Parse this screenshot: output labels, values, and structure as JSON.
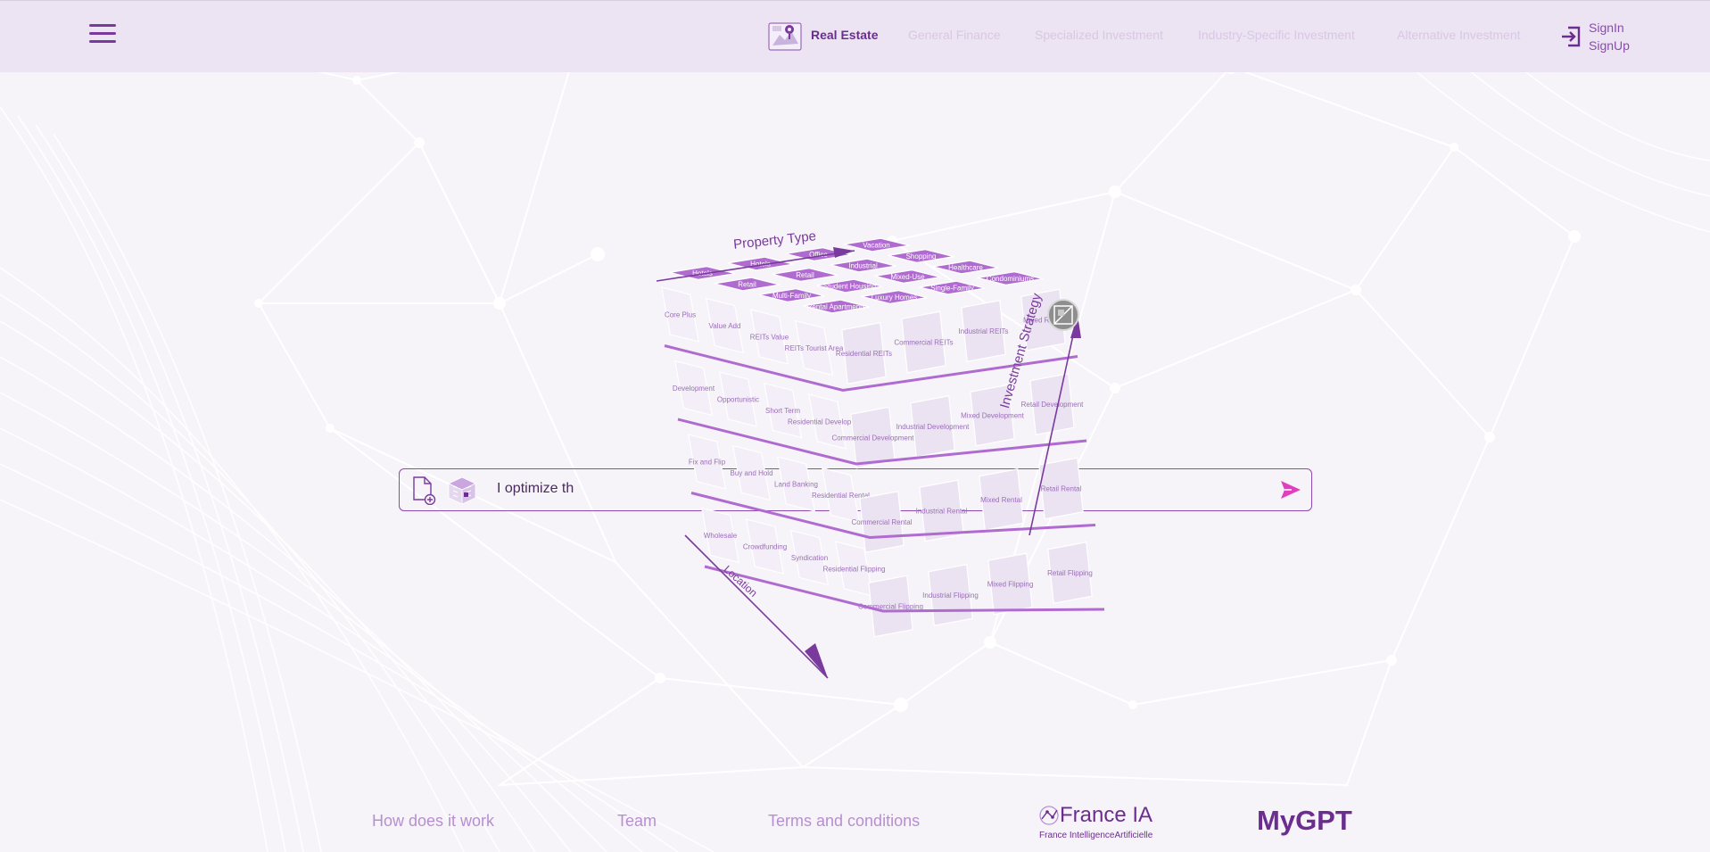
{
  "colors": {
    "accent": "#6b2e8f",
    "cube_top": "#b06bd0",
    "send": "#e040c0",
    "background": "#f6f3f9"
  },
  "header": {
    "menu_icon": "hamburger-menu-icon",
    "active_category": {
      "label": "Real Estate",
      "icon": "real-estate-map-icon"
    },
    "categories": [
      "General Finance",
      "Specialized Investment",
      "Industry-Specific Investment",
      "Alternative Investment"
    ],
    "auth": {
      "icon": "sign-in-icon",
      "signin": "SignIn",
      "signup": "SignUp"
    }
  },
  "cube": {
    "axes": {
      "top": "Property Type",
      "right": "Investment Strategy",
      "left": "Location"
    },
    "top_labels": [
      [
        "Hotels",
        "Hotels",
        "Office",
        "Vacation"
      ],
      [
        "Retail",
        "Retail",
        "Industrial",
        "Shopping"
      ],
      [
        "Multi-Family",
        "Student Housing",
        "Mixed-Use",
        "Healthcare"
      ],
      [
        "Rental Apartments",
        "Luxury Homes",
        "Single-Family",
        "Condominiums"
      ]
    ],
    "left_labels": [
      [
        "Core Plus",
        "Value Add",
        "REITs Value",
        "REITs Tourist Area"
      ],
      [
        "Development",
        "Opportunistic",
        "Short Term",
        "Residential Development"
      ],
      [
        "Fix and Flip",
        "Buy and Hold",
        "Land Banking",
        "Residential Rental"
      ],
      [
        "Wholesale",
        "Crowdfunding",
        "Syndication",
        "Residential Flipping"
      ]
    ],
    "right_labels": [
      [
        "Residential REITs",
        "Commercial REITs",
        "Industrial REITs",
        "Mixed REITs"
      ],
      [
        "Commercial Development",
        "Industrial Development",
        "Mixed Development",
        "Retail Development"
      ],
      [
        "Commercial Rental",
        "Industrial Rental",
        "Mixed Rental",
        "Retail Rental"
      ],
      [
        "Commercial Flipping",
        "Industrial Flipping",
        "Mixed Flipping",
        "Retail Flipping"
      ]
    ],
    "corner_button_icon": "reset-cube-icon"
  },
  "prompt": {
    "value": "I optimize th",
    "attach_icon": "attach-file-icon",
    "cube_icon": "mini-cube-icon",
    "send_icon": "send-icon"
  },
  "footer": {
    "links": [
      "How does it work",
      "Team",
      "Terms and conditions"
    ],
    "brand_fia": {
      "title": "France IA",
      "subtitle": "France IntelligenceArtificielle"
    },
    "brand_mygpt": "MyGPT"
  }
}
